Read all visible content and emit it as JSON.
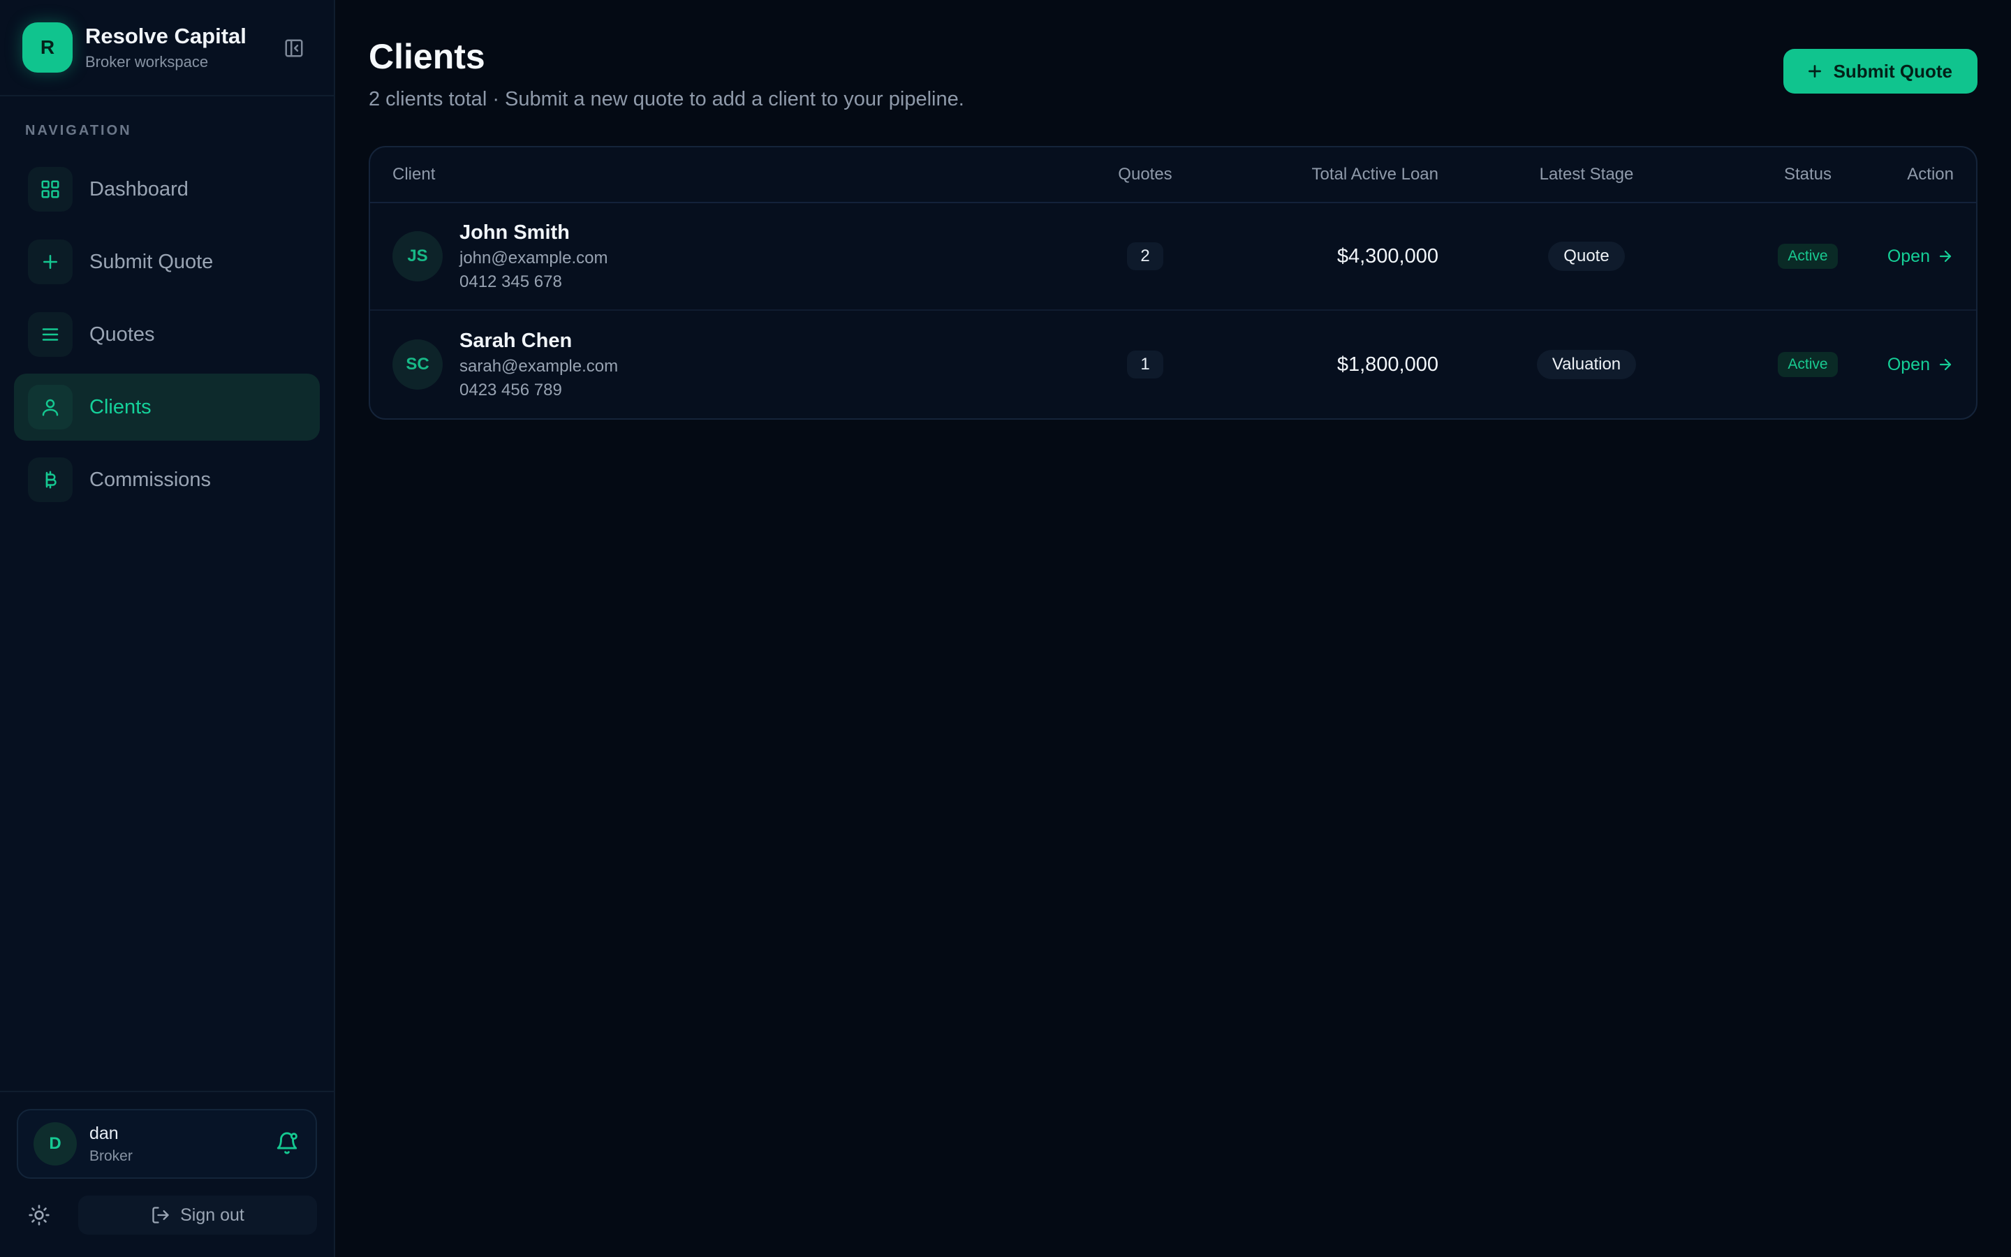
{
  "brand": {
    "logo_letter": "R",
    "name": "Resolve Capital",
    "subtitle": "Broker workspace"
  },
  "nav": {
    "heading": "NAVIGATION",
    "items": [
      {
        "label": "Dashboard",
        "icon": "grid-icon",
        "active": false
      },
      {
        "label": "Submit Quote",
        "icon": "plus-icon",
        "active": false
      },
      {
        "label": "Quotes",
        "icon": "list-icon",
        "active": false
      },
      {
        "label": "Clients",
        "icon": "user-icon",
        "active": true
      },
      {
        "label": "Commissions",
        "icon": "currency-icon",
        "active": false
      }
    ]
  },
  "user": {
    "initial": "D",
    "name": "dan",
    "role": "Broker"
  },
  "signout_label": "Sign out",
  "page": {
    "title": "Clients",
    "subtitle": "2 clients total · Submit a new quote to add a client to your pipeline.",
    "primary_button": "Submit Quote"
  },
  "table": {
    "columns": [
      "Client",
      "Quotes",
      "Total Active Loan",
      "Latest Stage",
      "Status",
      "Action"
    ],
    "rows": [
      {
        "initials": "JS",
        "name": "John Smith",
        "email": "john@example.com",
        "phone": "0412 345 678",
        "quotes": "2",
        "loan": "$4,300,000",
        "stage": "Quote",
        "status": "Active",
        "action": "Open"
      },
      {
        "initials": "SC",
        "name": "Sarah Chen",
        "email": "sarah@example.com",
        "phone": "0423 456 789",
        "quotes": "1",
        "loan": "$1,800,000",
        "stage": "Valuation",
        "status": "Active",
        "action": "Open"
      }
    ]
  },
  "colors": {
    "accent": "#10c48e",
    "background": "#040a14",
    "sidebar": "#061020"
  }
}
